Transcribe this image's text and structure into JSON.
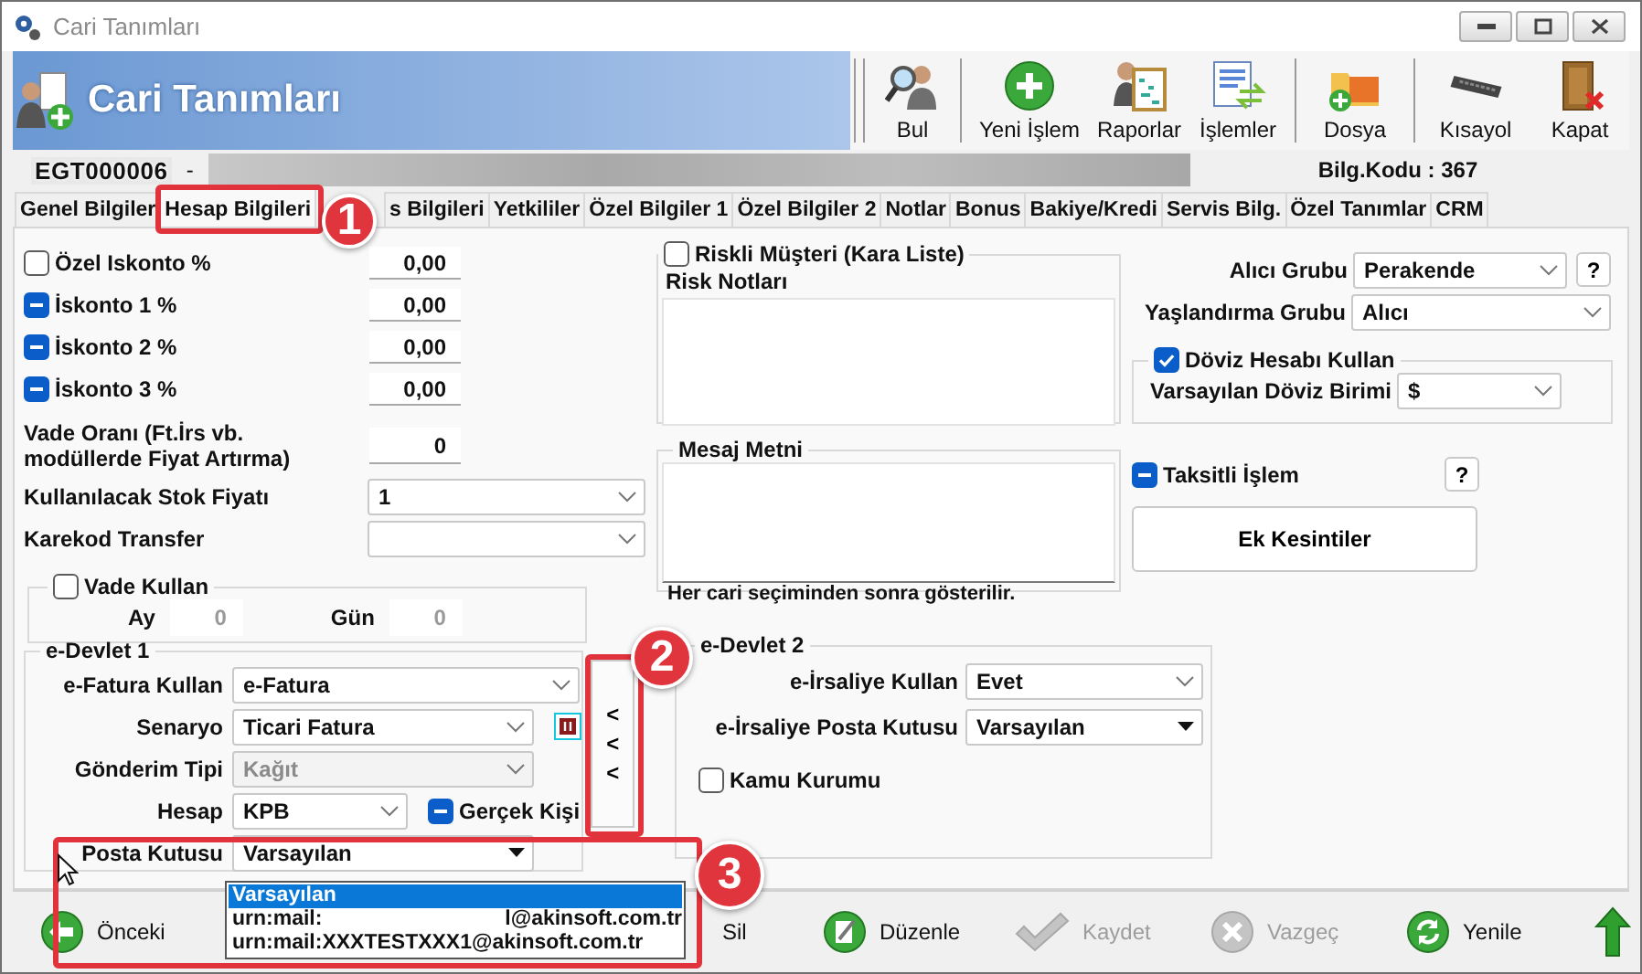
{
  "window": {
    "title": "Cari Tanımları"
  },
  "header": {
    "title": "Cari Tanımları",
    "tools": [
      {
        "label": "Bul"
      },
      {
        "label": "Yeni İşlem"
      },
      {
        "label": "Raporlar"
      },
      {
        "label": "İşlemler"
      },
      {
        "label": "Dosya"
      },
      {
        "label": "Kısayol"
      },
      {
        "label": "Kapat"
      }
    ]
  },
  "record": {
    "code": "EGT000006",
    "separator": "-",
    "info": "Bilg.Kodu : 367"
  },
  "tabs": [
    {
      "label": "Genel Bilgiler",
      "selected": false
    },
    {
      "label": "Hesap Bilgileri",
      "selected": true
    },
    {
      "label": "s Bilgileri",
      "selected": false
    },
    {
      "label": "Yetkililer",
      "selected": false
    },
    {
      "label": "Özel Bilgiler 1",
      "selected": false
    },
    {
      "label": "Özel Bilgiler 2",
      "selected": false
    },
    {
      "label": "Notlar",
      "selected": false
    },
    {
      "label": "Bonus",
      "selected": false
    },
    {
      "label": "Bakiye/Kredi",
      "selected": false
    },
    {
      "label": "Servis Bilg.",
      "selected": false
    },
    {
      "label": "Özel Tanımlar",
      "selected": false
    },
    {
      "label": "CRM",
      "selected": false
    }
  ],
  "discounts": [
    {
      "label": "Özel Iskonto %",
      "checked": false,
      "partial": false,
      "value": "0,00"
    },
    {
      "label": "İskonto 1 %",
      "checked": false,
      "partial": true,
      "value": "0,00"
    },
    {
      "label": "İskonto 2 %",
      "checked": false,
      "partial": true,
      "value": "0,00"
    },
    {
      "label": "İskonto 3 %",
      "checked": false,
      "partial": true,
      "value": "0,00"
    }
  ],
  "vade_orani": {
    "label": "Vade Oranı (Ft.İrs vb. modüllerde Fiyat Artırma)",
    "value": "0"
  },
  "stock_price": {
    "label": "Kullanılacak Stok Fiyatı",
    "value": "1"
  },
  "karekod": {
    "label": "Karekod Transfer"
  },
  "vade_kullan": {
    "label": "Vade Kullan",
    "checked": false,
    "month_label": "Ay",
    "month": "0",
    "day_label": "Gün",
    "day": "0"
  },
  "risk": {
    "label": "Riskli Müşteri (Kara Liste)",
    "checked": false,
    "notes_label": "Risk Notları"
  },
  "message": {
    "legend": "Mesaj Metni",
    "note": "Her cari seçiminden sonra gösterilir."
  },
  "buyer_group": {
    "label": "Alıcı Grubu",
    "value": "Perakende",
    "help": "?"
  },
  "aging_group": {
    "label": "Yaşlandırma Grubu",
    "value": "Alıcı"
  },
  "currency": {
    "label": "Döviz Hesabı Kullan",
    "checked": true,
    "unit_label": "Varsayılan Döviz Birimi",
    "unit": "$"
  },
  "installment": {
    "label": "Taksitli İşlem",
    "checked": false,
    "partial": true,
    "help": "?"
  },
  "extra_button": "Ek Kesintiler",
  "edevlet1": {
    "legend": "e-Devlet 1",
    "fields": [
      {
        "label": "e-Fatura Kullan",
        "value": "e-Fatura",
        "kind": "combobox",
        "disabled": false
      },
      {
        "label": "Senaryo",
        "value": "Ticari Fatura",
        "kind": "combobox",
        "disabled": false
      },
      {
        "label": "Gönderim Tipi",
        "value": "Kağıt",
        "kind": "combobox",
        "disabled": true
      },
      {
        "label": "Hesap",
        "value": "KPB",
        "kind": "combobox",
        "disabled": false
      },
      {
        "label": "Posta Kutusu",
        "value": "Varsayılan",
        "kind": "dropdown",
        "disabled": false
      }
    ],
    "real_person": {
      "label": "Gerçek Kişi",
      "checked": false,
      "partial": true
    }
  },
  "collapse_button": "<<<",
  "edevlet2": {
    "legend": "e-Devlet 2",
    "fields": [
      {
        "label": "e-İrsaliye Kullan",
        "value": "Evet",
        "kind": "combobox",
        "disabled": false
      },
      {
        "label": "e-İrsaliye Posta Kutusu",
        "value": "Varsayılan",
        "kind": "dropdown",
        "disabled": false
      }
    ],
    "public": {
      "label": "Kamu Kurumu",
      "checked": false
    }
  },
  "dropdown_list": [
    {
      "parts": [
        "Varsayılan"
      ],
      "selected": true
    },
    {
      "parts": [
        "urn:mail:",
        "l@akinsoft.com.tr"
      ],
      "selected": false
    },
    {
      "parts": [
        "urn:mail:XXXTESTXXX1@akinsoft.com.tr"
      ],
      "selected": false
    }
  ],
  "footer": [
    {
      "label": "Önceki",
      "disabled": false
    },
    {
      "label": "Sil",
      "disabled": false
    },
    {
      "label": "Düzenle",
      "disabled": false
    },
    {
      "label": "Kaydet",
      "disabled": true
    },
    {
      "label": "Vazgeç",
      "disabled": true
    },
    {
      "label": "Yenile",
      "disabled": false
    }
  ],
  "annotations": [
    {
      "number": "1"
    },
    {
      "number": "2"
    },
    {
      "number": "3"
    }
  ]
}
